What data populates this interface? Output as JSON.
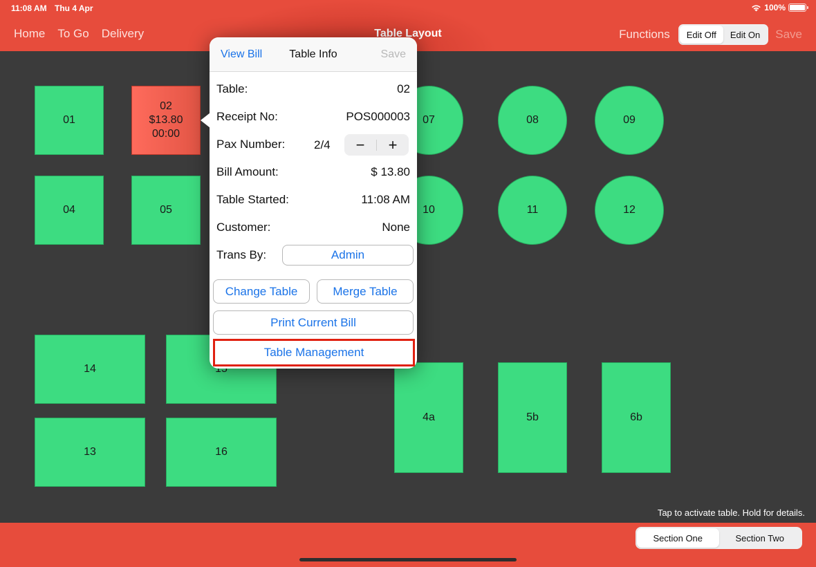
{
  "status_bar": {
    "time": "11:08 AM",
    "date": "Thu 4 Apr",
    "battery_percent": "100%",
    "battery_level": 1.0
  },
  "nav": {
    "left_links": [
      "Home",
      "To Go",
      "Delivery"
    ],
    "title": "Table Layout",
    "functions_label": "Functions",
    "edit_toggle": {
      "options": [
        "Edit Off",
        "Edit On"
      ],
      "selected": "Edit Off"
    },
    "save_label": "Save"
  },
  "tables": [
    {
      "id": "01",
      "shape": "square",
      "status": "free"
    },
    {
      "id": "02",
      "shape": "square",
      "status": "occupied",
      "amount": "$13.80",
      "elapsed": "00:00"
    },
    {
      "id": "04",
      "shape": "square",
      "status": "free"
    },
    {
      "id": "05",
      "shape": "square",
      "status": "free"
    },
    {
      "id": "07",
      "shape": "round",
      "status": "free"
    },
    {
      "id": "08",
      "shape": "round",
      "status": "free"
    },
    {
      "id": "09",
      "shape": "round",
      "status": "free"
    },
    {
      "id": "10",
      "shape": "round",
      "status": "free"
    },
    {
      "id": "11",
      "shape": "round",
      "status": "free"
    },
    {
      "id": "12",
      "shape": "round",
      "status": "free"
    },
    {
      "id": "14",
      "shape": "rect-wide",
      "status": "free"
    },
    {
      "id": "15",
      "shape": "rect-wide",
      "status": "free"
    },
    {
      "id": "13",
      "shape": "rect-wide",
      "status": "free"
    },
    {
      "id": "16",
      "shape": "rect-wide",
      "status": "free"
    },
    {
      "id": "4a",
      "shape": "rect-tall",
      "status": "free"
    },
    {
      "id": "5b",
      "shape": "rect-tall",
      "status": "free"
    },
    {
      "id": "6b",
      "shape": "rect-tall",
      "status": "free"
    }
  ],
  "popover": {
    "view_bill_label": "View Bill",
    "title": "Table Info",
    "save_label": "Save",
    "fields": {
      "table": {
        "label": "Table:",
        "value": "02"
      },
      "receipt": {
        "label": "Receipt No:",
        "value": "POS000003"
      },
      "pax": {
        "label": "Pax Number:",
        "value": "2/4",
        "minus": "−",
        "plus": "+"
      },
      "bill": {
        "label": "Bill Amount:",
        "value": "$ 13.80"
      },
      "started": {
        "label": "Table Started:",
        "value": "11:08 AM"
      },
      "customer": {
        "label": "Customer:",
        "value": "None"
      },
      "trans_by": {
        "label": "Trans By:",
        "value": "Admin"
      }
    },
    "buttons": {
      "change_table": "Change Table",
      "merge_table": "Merge Table",
      "print_bill": "Print Current Bill",
      "table_management": "Table Management"
    }
  },
  "hint": "Tap to activate table. Hold for details.",
  "sections": {
    "options": [
      "Section One",
      "Section Two"
    ],
    "selected": "Section One"
  },
  "colors": {
    "brand": "#e74c3c",
    "table_free": "#3ddc81",
    "table_occupied": "#ff6b5c",
    "link": "#1a73e8",
    "highlight": "#e02010"
  }
}
